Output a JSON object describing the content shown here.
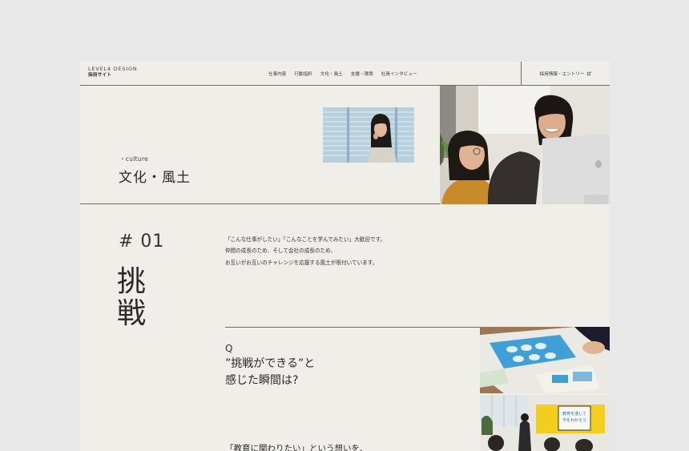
{
  "header": {
    "logo_line1": "LEVEL4 DESIGN",
    "logo_line2": "採用サイト",
    "nav": [
      "仕事内容",
      "行動指針",
      "文化・風土",
      "支援・環境",
      "社員インタビュー"
    ],
    "entry_label": "採用情報・エントリー",
    "entry_icon": "external-link-icon"
  },
  "hero": {
    "subtitle": "・culture",
    "title": "文化・風土"
  },
  "section": {
    "number": "# 01",
    "kanji_line1": "挑",
    "kanji_line2": "戦",
    "intro_lines": [
      "「こんな仕事がしたい」「こんなことを学んでみたい」大歓迎です。",
      "仲間の成長のため、そして会社の成長のため、",
      "お互いがお互いのチャレンジを応援する風土が根付いています。"
    ],
    "q_label": "Q",
    "question_line1": "”挑戦ができる”と",
    "question_line2": "感じた瞬間は?",
    "answer_start": "「教育に関わりたい」という想いを、"
  },
  "screen": {
    "slide_text_line1": "教育を通して",
    "slide_text_line2": "今をわかろう"
  },
  "colors": {
    "page_bg": "#e8e8e8",
    "frame_bg": "#efeee9",
    "line": "#6d6b67",
    "text": "#2a2a2a"
  }
}
